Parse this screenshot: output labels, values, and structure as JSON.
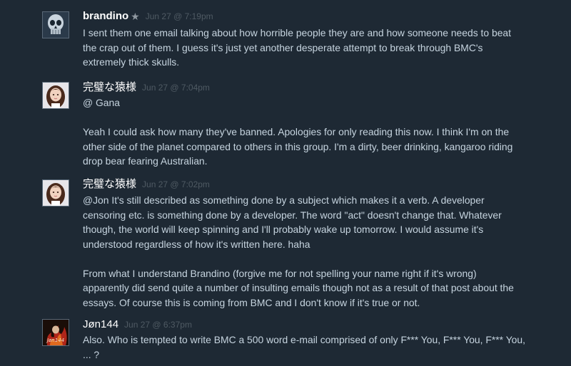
{
  "comments": [
    {
      "author": "brandino",
      "badge": "★",
      "time": "Jun 27 @ 7:19pm",
      "avatar": "skull-avatar",
      "paragraphs": [
        "I sent them one email talking about how horrible people they are and how someone needs to beat the crap out of them. I guess it's just yet another desperate attempt to break through BMC's extremely thick skulls."
      ]
    },
    {
      "author": "完璧な猿様",
      "time": "Jun 27 @ 7:04pm",
      "avatar": "girl-avatar",
      "paragraphs": [
        "@ Gana",
        "Yeah I could ask how many they've banned. Apologies for only reading this now. I think I'm on the other side of the planet compared to others in this group. I'm a dirty, beer drinking, kangaroo riding drop bear fearing Australian."
      ]
    },
    {
      "author": "完璧な猿様",
      "time": "Jun 27 @ 7:02pm",
      "avatar": "girl-avatar",
      "paragraphs": [
        "@Jon It's still described as something done by a subject which makes it a verb. A developer censoring etc. is something done by a developer. The word \"act\" doesn't change that. Whatever though, the world will keep spinning and I'll probably wake up tomorrow. I would assume it's understood regardless of how it's written here. haha",
        "From what I understand Brandino (forgive me for not spelling your name right if it's wrong) apparently did send quite a number of insulting emails though not as a result of that post about the essays. Of course this is coming from BMC and I don't know if it's true or not."
      ]
    },
    {
      "author": "Jøn144",
      "time": "Jun 27 @ 6:37pm",
      "avatar": "fire-avatar",
      "avatar_text": "Jøn144",
      "paragraphs": [
        "Also. Who is tempted to write BMC a 500 word e-mail comprised of only F*** You, F*** You, F*** You, ... ?"
      ]
    }
  ]
}
